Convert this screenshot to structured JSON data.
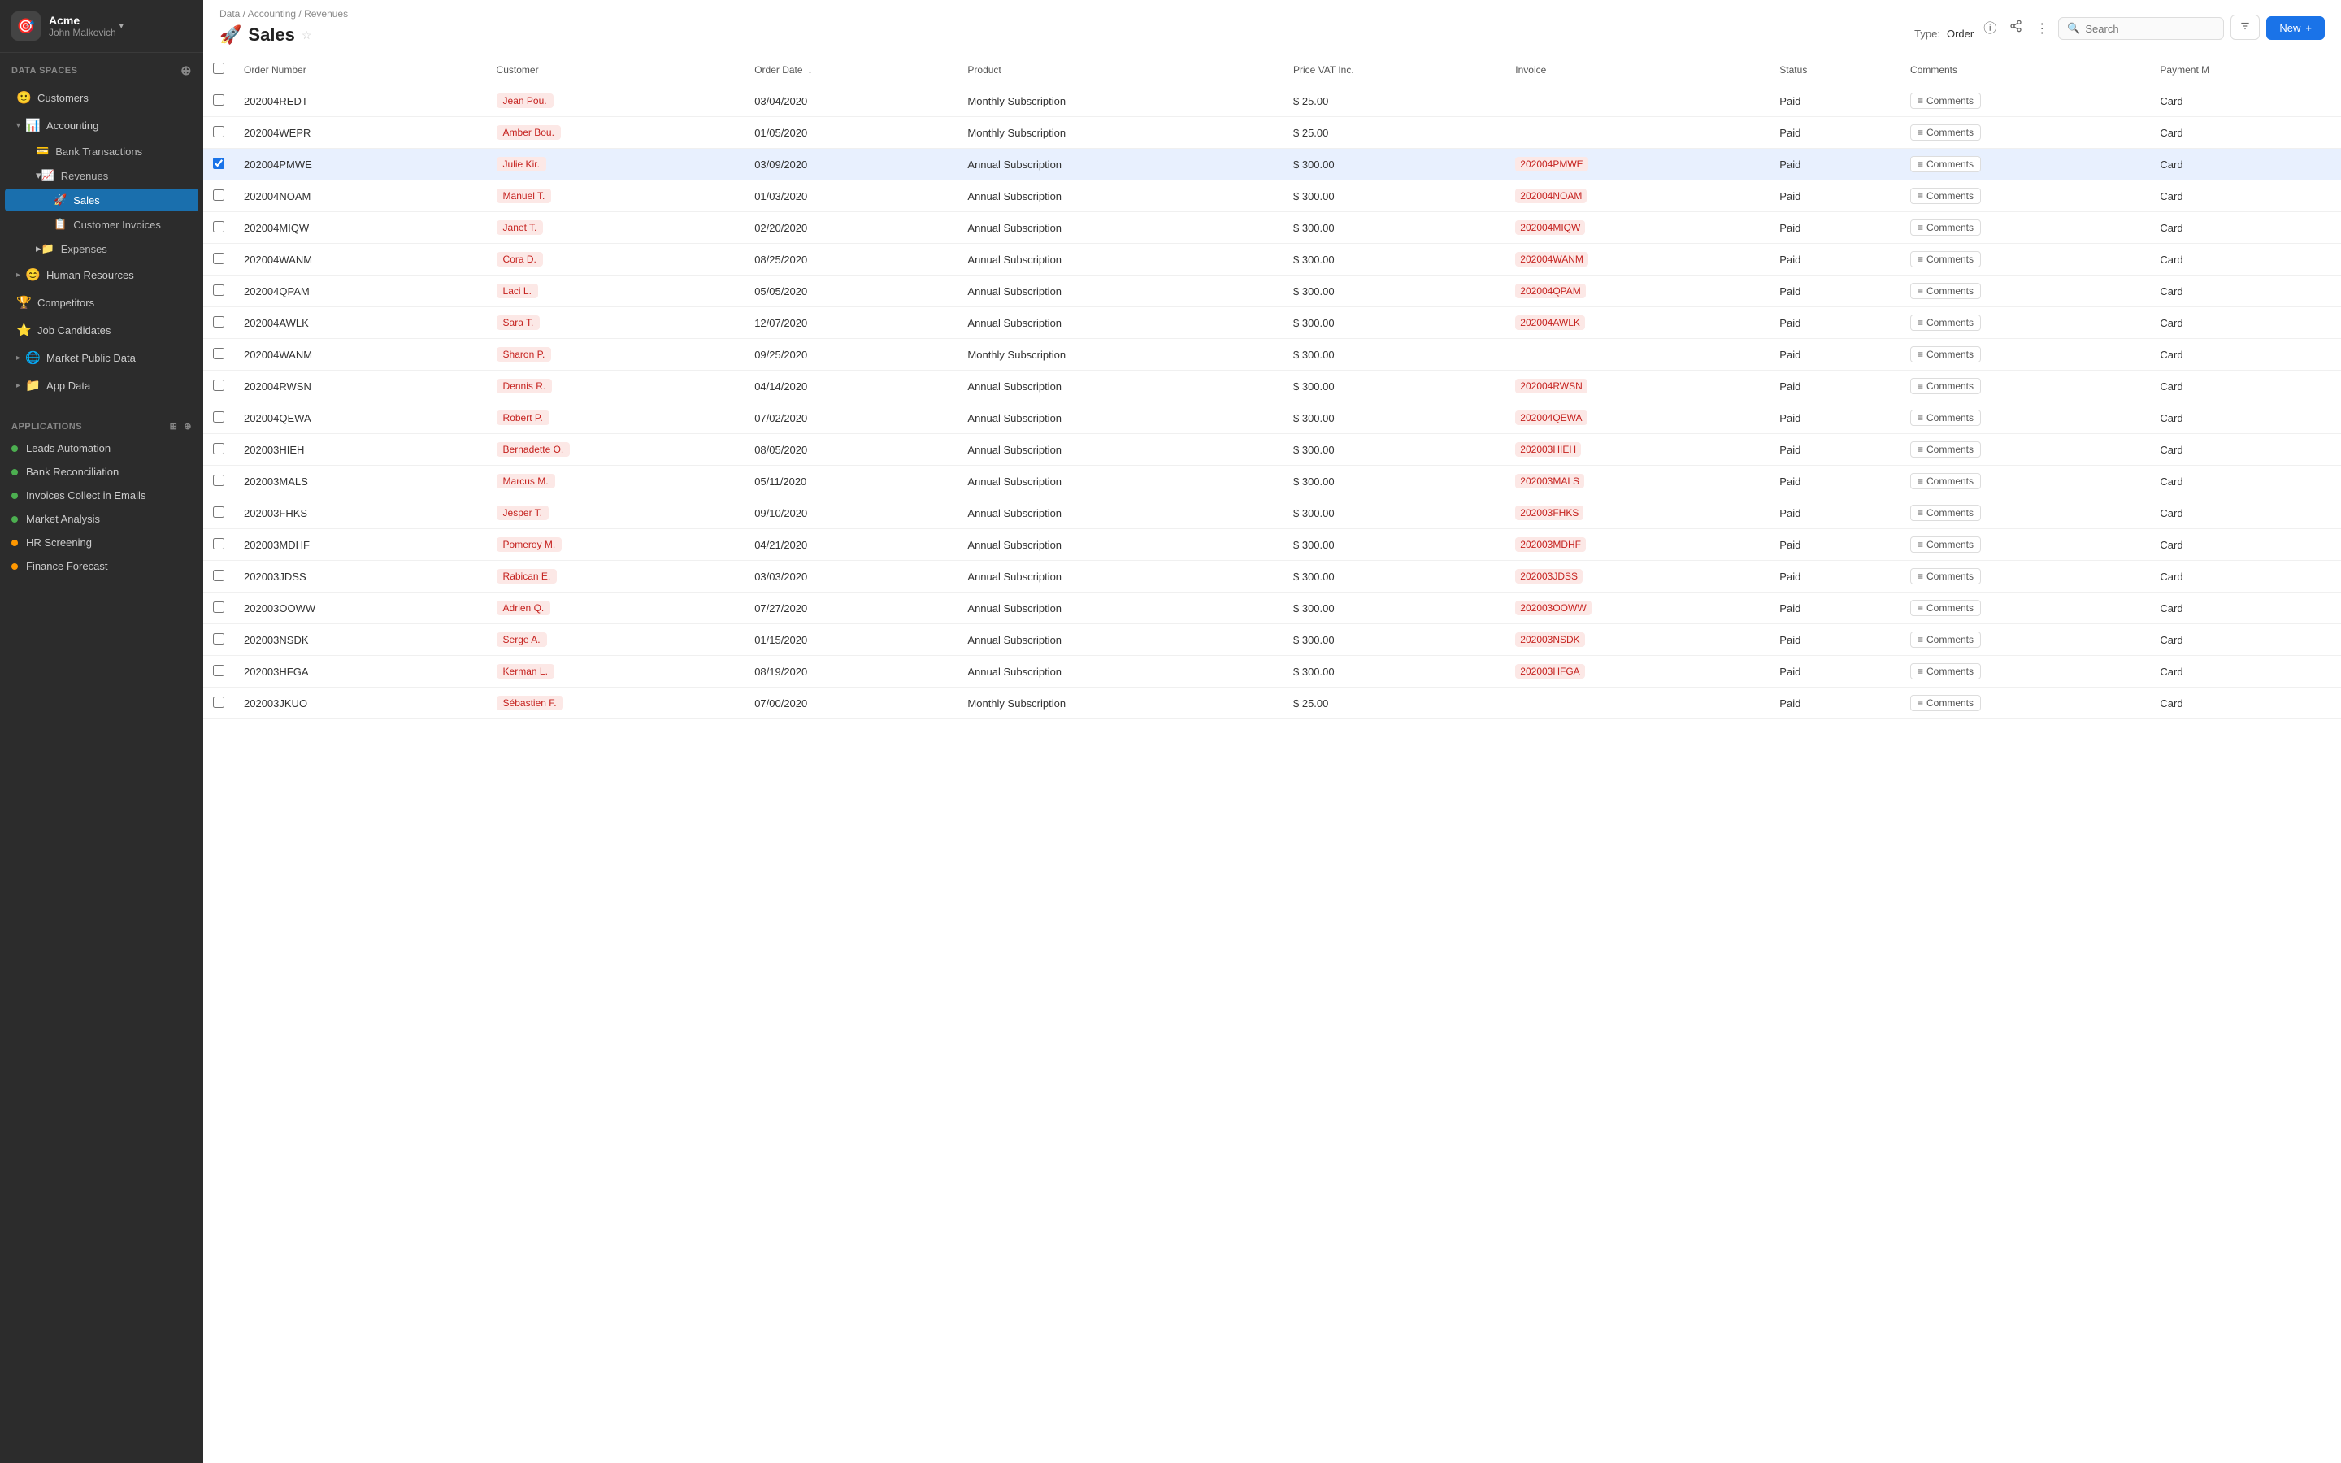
{
  "sidebar": {
    "app": {
      "name": "Acme",
      "user": "John Malkovich",
      "logo": "🎯"
    },
    "data_spaces_label": "Data Spaces",
    "items": [
      {
        "id": "customers",
        "icon": "🙂",
        "label": "Customers",
        "chevron": "",
        "indent": 0
      },
      {
        "id": "accounting",
        "icon": "📊",
        "label": "Accounting",
        "chevron": "▾",
        "indent": 0
      },
      {
        "id": "bank-transactions",
        "icon": "💳",
        "label": "Bank Transactions",
        "chevron": "",
        "indent": 1
      },
      {
        "id": "revenues",
        "icon": "📈",
        "label": "Revenues",
        "chevron": "▾",
        "indent": 1
      },
      {
        "id": "sales",
        "icon": "🚀",
        "label": "Sales",
        "chevron": "",
        "indent": 2,
        "active": true
      },
      {
        "id": "customer-invoices",
        "icon": "📋",
        "label": "Customer Invoices",
        "chevron": "",
        "indent": 2
      },
      {
        "id": "expenses",
        "icon": "📁",
        "label": "Expenses",
        "chevron": "▸",
        "indent": 1
      },
      {
        "id": "human-resources",
        "icon": "😊",
        "label": "Human Resources",
        "chevron": "▸",
        "indent": 0
      },
      {
        "id": "competitors",
        "icon": "🏆",
        "label": "Competitors",
        "chevron": "",
        "indent": 0
      },
      {
        "id": "job-candidates",
        "icon": "⭐",
        "label": "Job Candidates",
        "chevron": "",
        "indent": 0
      },
      {
        "id": "market-public-data",
        "icon": "🌐",
        "label": "Market Public Data",
        "chevron": "▸",
        "indent": 0
      },
      {
        "id": "app-data",
        "icon": "📁",
        "label": "App Data",
        "chevron": "▸",
        "indent": 0
      }
    ],
    "applications_label": "Applications",
    "apps": [
      {
        "id": "leads-automation",
        "label": "Leads Automation",
        "color": "#4caf50"
      },
      {
        "id": "bank-reconciliation",
        "label": "Bank Reconciliation",
        "color": "#4caf50"
      },
      {
        "id": "invoices-collect",
        "label": "Invoices Collect in Emails",
        "color": "#4caf50"
      },
      {
        "id": "market-analysis",
        "label": "Market Analysis",
        "color": "#4caf50"
      },
      {
        "id": "hr-screening",
        "label": "HR Screening",
        "color": "#ff9800"
      },
      {
        "id": "finance-forecast",
        "label": "Finance Forecast",
        "color": "#ff9800"
      }
    ]
  },
  "topbar": {
    "breadcrumb": "Data / Accounting / Revenues",
    "title": "Sales",
    "title_icon": "🚀",
    "type_label": "Type:",
    "type_value": "Order",
    "search_placeholder": "Search",
    "new_button": "New"
  },
  "table": {
    "columns": [
      {
        "id": "order-number",
        "label": "Order Number"
      },
      {
        "id": "customer",
        "label": "Customer"
      },
      {
        "id": "order-date",
        "label": "Order Date",
        "sortable": true
      },
      {
        "id": "product",
        "label": "Product"
      },
      {
        "id": "price-vat",
        "label": "Price VAT Inc."
      },
      {
        "id": "invoice",
        "label": "Invoice"
      },
      {
        "id": "status",
        "label": "Status"
      },
      {
        "id": "comments",
        "label": "Comments"
      },
      {
        "id": "payment-m",
        "label": "Payment M"
      }
    ],
    "rows": [
      {
        "order": "202004REDT",
        "customer": "Jean Pou.",
        "date": "03/04/2020",
        "product": "Monthly Subscription",
        "price": "$ 25.00",
        "invoice": "",
        "status": "Paid",
        "payment": "Card",
        "checked": false
      },
      {
        "order": "202004WEPR",
        "customer": "Amber Bou.",
        "date": "01/05/2020",
        "product": "Monthly Subscription",
        "price": "$ 25.00",
        "invoice": "",
        "status": "Paid",
        "payment": "Card",
        "checked": false
      },
      {
        "order": "202004PMWE",
        "customer": "Julie Kir.",
        "date": "03/09/2020",
        "product": "Annual Subscription",
        "price": "$ 300.00",
        "invoice": "202004PMWE",
        "status": "Paid",
        "payment": "Card",
        "checked": true
      },
      {
        "order": "202004NOAM",
        "customer": "Manuel T.",
        "date": "01/03/2020",
        "product": "Annual Subscription",
        "price": "$ 300.00",
        "invoice": "202004NOAM",
        "status": "Paid",
        "payment": "Card",
        "checked": false
      },
      {
        "order": "202004MIQW",
        "customer": "Janet T.",
        "date": "02/20/2020",
        "product": "Annual Subscription",
        "price": "$ 300.00",
        "invoice": "202004MIQW",
        "status": "Paid",
        "payment": "Card",
        "checked": false
      },
      {
        "order": "202004WANM",
        "customer": "Cora D.",
        "date": "08/25/2020",
        "product": "Annual Subscription",
        "price": "$ 300.00",
        "invoice": "202004WANM",
        "status": "Paid",
        "payment": "Card",
        "checked": false
      },
      {
        "order": "202004QPAM",
        "customer": "Laci L.",
        "date": "05/05/2020",
        "product": "Annual Subscription",
        "price": "$ 300.00",
        "invoice": "202004QPAM",
        "status": "Paid",
        "payment": "Card",
        "checked": false
      },
      {
        "order": "202004AWLK",
        "customer": "Sara T.",
        "date": "12/07/2020",
        "product": "Annual Subscription",
        "price": "$ 300.00",
        "invoice": "202004AWLK",
        "status": "Paid",
        "payment": "Card",
        "checked": false
      },
      {
        "order": "202004WANM",
        "customer": "Sharon P.",
        "date": "09/25/2020",
        "product": "Monthly Subscription",
        "price": "$ 300.00",
        "invoice": "",
        "status": "Paid",
        "payment": "Card",
        "checked": false
      },
      {
        "order": "202004RWSN",
        "customer": "Dennis R.",
        "date": "04/14/2020",
        "product": "Annual Subscription",
        "price": "$ 300.00",
        "invoice": "202004RWSN",
        "status": "Paid",
        "payment": "Card",
        "checked": false
      },
      {
        "order": "202004QEWA",
        "customer": "Robert P.",
        "date": "07/02/2020",
        "product": "Annual Subscription",
        "price": "$ 300.00",
        "invoice": "202004QEWA",
        "status": "Paid",
        "payment": "Card",
        "checked": false
      },
      {
        "order": "202003HIEH",
        "customer": "Bernadette O.",
        "date": "08/05/2020",
        "product": "Annual Subscription",
        "price": "$ 300.00",
        "invoice": "202003HIEH",
        "status": "Paid",
        "payment": "Card",
        "checked": false
      },
      {
        "order": "202003MALS",
        "customer": "Marcus M.",
        "date": "05/11/2020",
        "product": "Annual Subscription",
        "price": "$ 300.00",
        "invoice": "202003MALS",
        "status": "Paid",
        "payment": "Card",
        "checked": false
      },
      {
        "order": "202003FHKS",
        "customer": "Jesper T.",
        "date": "09/10/2020",
        "product": "Annual Subscription",
        "price": "$ 300.00",
        "invoice": "202003FHKS",
        "status": "Paid",
        "payment": "Card",
        "checked": false
      },
      {
        "order": "202003MDHF",
        "customer": "Pomeroy M.",
        "date": "04/21/2020",
        "product": "Annual Subscription",
        "price": "$ 300.00",
        "invoice": "202003MDHF",
        "status": "Paid",
        "payment": "Card",
        "checked": false
      },
      {
        "order": "202003JDSS",
        "customer": "Rabican E.",
        "date": "03/03/2020",
        "product": "Annual Subscription",
        "price": "$ 300.00",
        "invoice": "202003JDSS",
        "status": "Paid",
        "payment": "Card",
        "checked": false
      },
      {
        "order": "202003OOWW",
        "customer": "Adrien Q.",
        "date": "07/27/2020",
        "product": "Annual Subscription",
        "price": "$ 300.00",
        "invoice": "202003OOWW",
        "status": "Paid",
        "payment": "Card",
        "checked": false
      },
      {
        "order": "202003NSDK",
        "customer": "Serge A.",
        "date": "01/15/2020",
        "product": "Annual Subscription",
        "price": "$ 300.00",
        "invoice": "202003NSDK",
        "status": "Paid",
        "payment": "Card",
        "checked": false
      },
      {
        "order": "202003HFGA",
        "customer": "Kerman L.",
        "date": "08/19/2020",
        "product": "Annual Subscription",
        "price": "$ 300.00",
        "invoice": "202003HFGA",
        "status": "Paid",
        "payment": "Card",
        "checked": false
      },
      {
        "order": "202003JKUO",
        "customer": "Sébastien F.",
        "date": "07/00/2020",
        "product": "Monthly Subscription",
        "price": "$ 25.00",
        "invoice": "",
        "status": "Paid",
        "payment": "Card",
        "checked": false
      }
    ]
  }
}
